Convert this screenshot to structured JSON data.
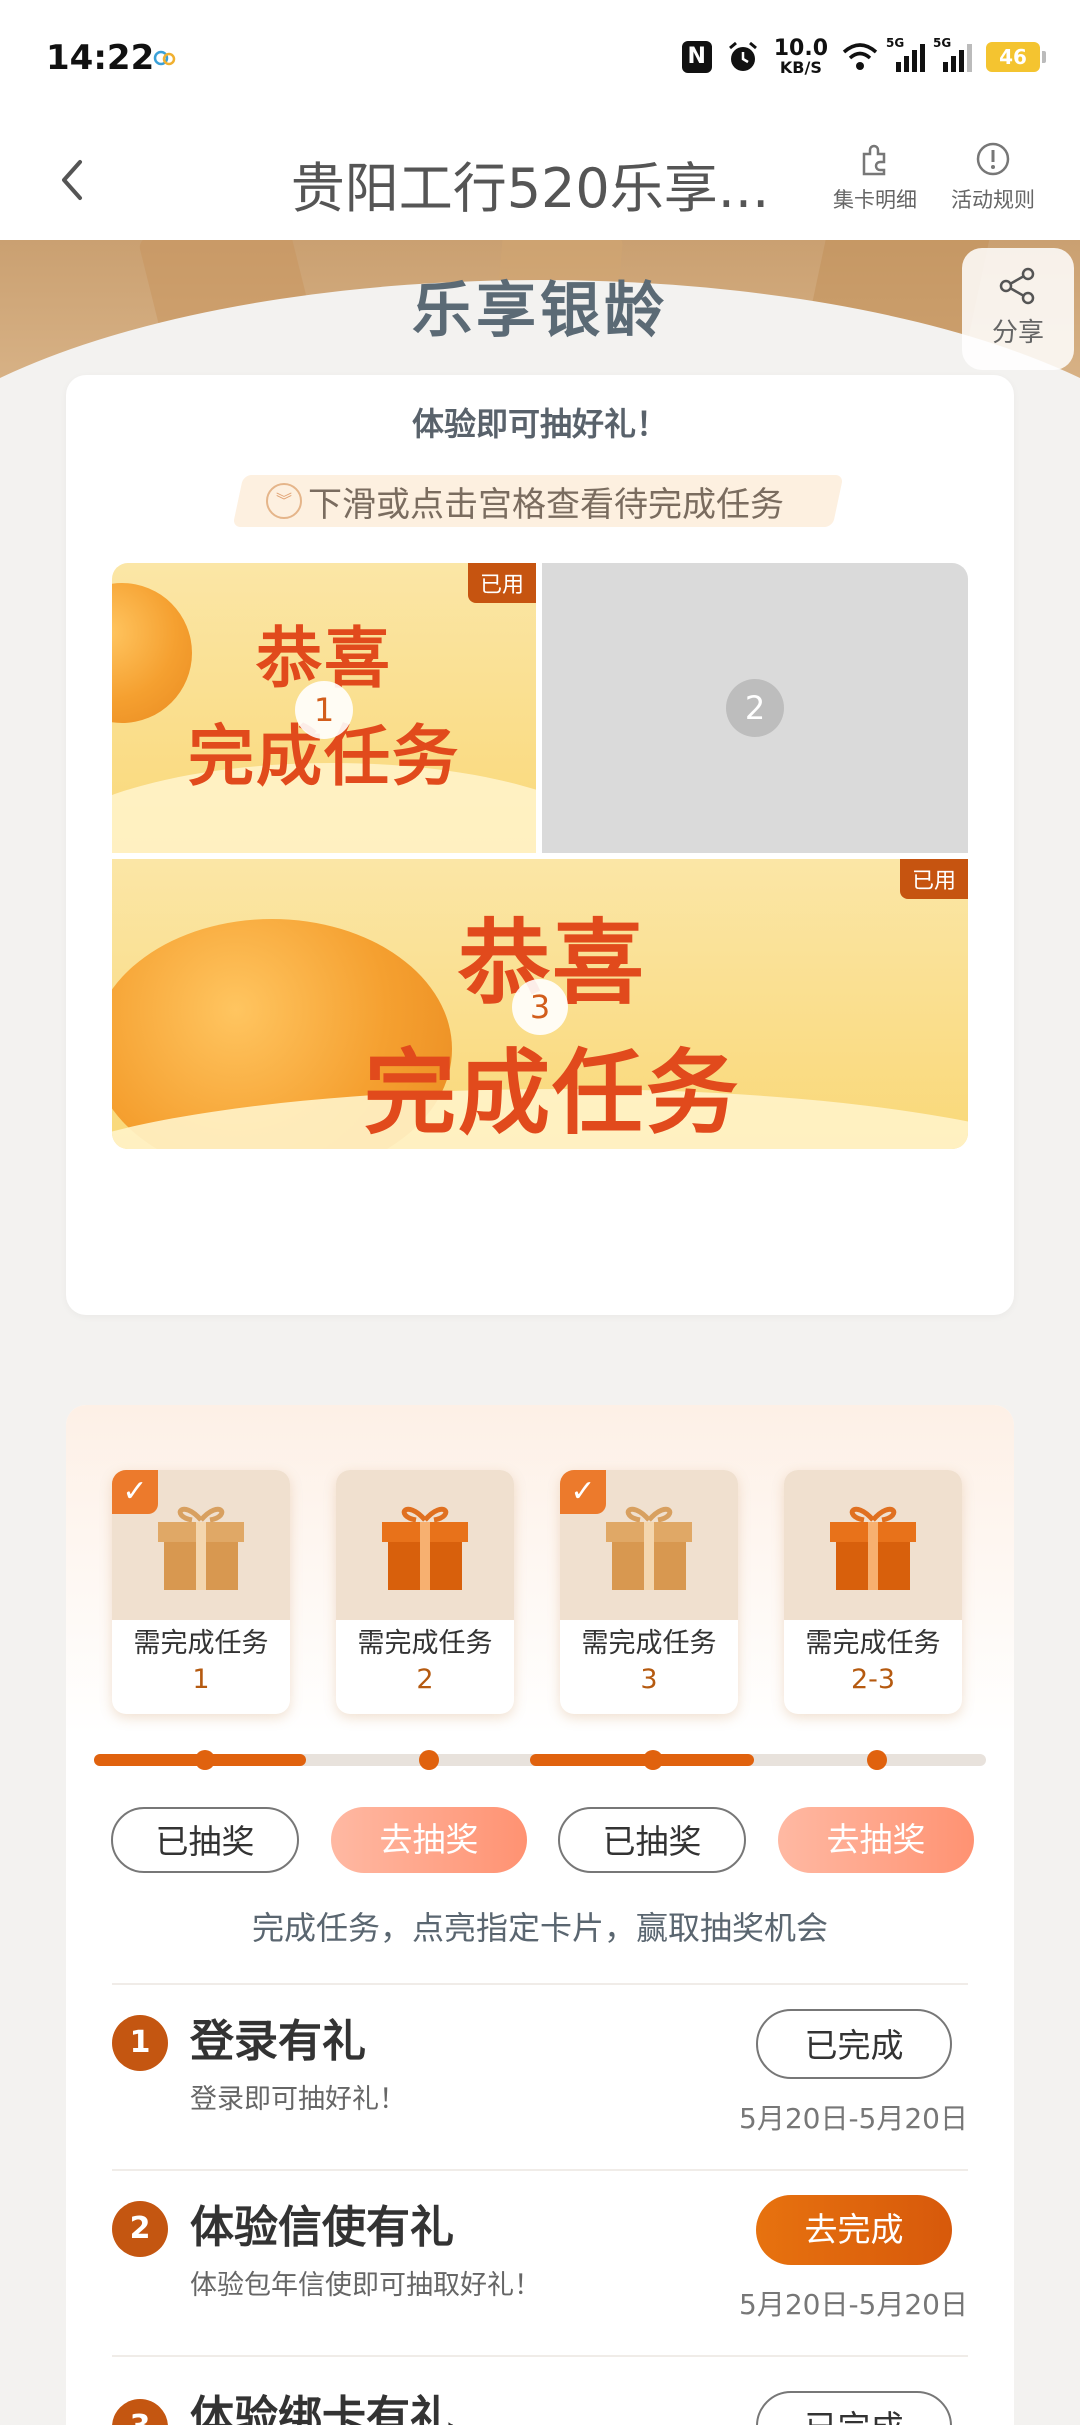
{
  "status_bar": {
    "time": "14:22",
    "speed_value": "10.0",
    "speed_unit": "KB/S",
    "signal_label": "5G",
    "battery": "46"
  },
  "nav": {
    "title": "贵阳工行520乐享...",
    "actions": [
      {
        "label": "集卡明细",
        "icon": "puzzle-icon"
      },
      {
        "label": "活动规则",
        "icon": "info-icon"
      }
    ]
  },
  "banner": {
    "title": "乐享银龄",
    "share_label": "分享"
  },
  "lottery_card": {
    "heading": "体验即可抽好礼！",
    "hint": "下滑或点击宫格查看待完成任务",
    "tiles": [
      {
        "number": "1",
        "state": "done",
        "tag": "已用",
        "line1": "恭喜",
        "line2": "完成任务"
      },
      {
        "number": "2",
        "state": "blank"
      },
      {
        "number": "3",
        "state": "done",
        "tag": "已用",
        "line1": "恭喜",
        "line2": "完成任务"
      }
    ]
  },
  "reward_card": {
    "gifts": [
      {
        "requirement": "需完成任务",
        "task": "1",
        "checked": true,
        "button": "已抽奖",
        "button_state": "done"
      },
      {
        "requirement": "需完成任务",
        "task": "2",
        "checked": false,
        "button": "去抽奖",
        "button_state": "go"
      },
      {
        "requirement": "需完成任务",
        "task": "3",
        "checked": true,
        "button": "已抽奖",
        "button_state": "done"
      },
      {
        "requirement": "需完成任务",
        "task": "2-3",
        "checked": false,
        "button": "去抽奖",
        "button_state": "go"
      }
    ],
    "caption": "完成任务，点亮指定卡片，赢取抽奖机会",
    "tasks": [
      {
        "number": "1",
        "title": "登录有礼",
        "subtitle": "登录即可抽好礼！",
        "button": "已完成",
        "button_state": "done",
        "date": "5月20日-5月20日"
      },
      {
        "number": "2",
        "title": "体验信使有礼",
        "subtitle": "体验包年信使即可抽取好礼！",
        "button": "去完成",
        "button_state": "go",
        "date": "5月20日-5月20日"
      },
      {
        "number": "3",
        "title": "体验绑卡有礼",
        "subtitle": "",
        "button": "已完成",
        "button_state": "done",
        "date": ""
      }
    ]
  },
  "colors": {
    "accent": "#e0620e",
    "brand_dark": "#c45611",
    "banner": "#caa071"
  }
}
